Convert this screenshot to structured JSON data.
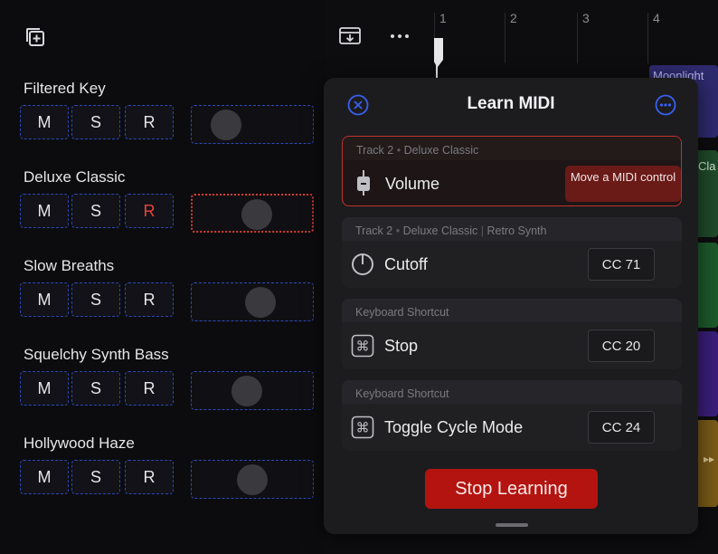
{
  "tracks": [
    {
      "name": "Filtered Key",
      "mute": "M",
      "solo": "S",
      "record": "R",
      "knob_position": 0.18
    },
    {
      "name": "Deluxe Classic",
      "mute": "M",
      "solo": "S",
      "record": "R",
      "knob_position": 0.55
    },
    {
      "name": "Slow Breaths",
      "mute": "M",
      "solo": "S",
      "record": "R",
      "knob_position": 0.6
    },
    {
      "name": "Squelchy Synth Bass",
      "mute": "M",
      "solo": "S",
      "record": "R",
      "knob_position": 0.44
    },
    {
      "name": "Hollywood Haze",
      "mute": "M",
      "solo": "S",
      "record": "R",
      "knob_position": 0.5
    }
  ],
  "ruler": {
    "bars": [
      "1",
      "2",
      "3",
      "4"
    ]
  },
  "regions": {
    "top_label": "Moonlight",
    "second_label": "Cla"
  },
  "learn_midi": {
    "title": "Learn MIDI",
    "assignments": [
      {
        "source": "Track 2",
        "sep": "•",
        "detail": "Deluxe Classic",
        "extra": "",
        "label": "Volume",
        "status": "Move a MIDI control",
        "icon": "fader-icon"
      },
      {
        "source": "Track 2",
        "sep": "•",
        "detail": "Deluxe Classic",
        "extra": "Retro Synth",
        "label": "Cutoff",
        "status": "CC 71",
        "icon": "knob-icon"
      },
      {
        "source": "Keyboard Shortcut",
        "sep": "",
        "detail": "",
        "extra": "",
        "label": "Stop",
        "status": "CC 20",
        "icon": "command-icon"
      },
      {
        "source": "Keyboard Shortcut",
        "sep": "",
        "detail": "",
        "extra": "",
        "label": "Toggle Cycle Mode",
        "status": "CC 24",
        "icon": "command-icon"
      }
    ],
    "stop_button": "Stop Learning"
  },
  "colors": {
    "accent_blue": "#3a5ff0",
    "learn_red": "#c0322d",
    "stop_button": "#b3140f"
  }
}
